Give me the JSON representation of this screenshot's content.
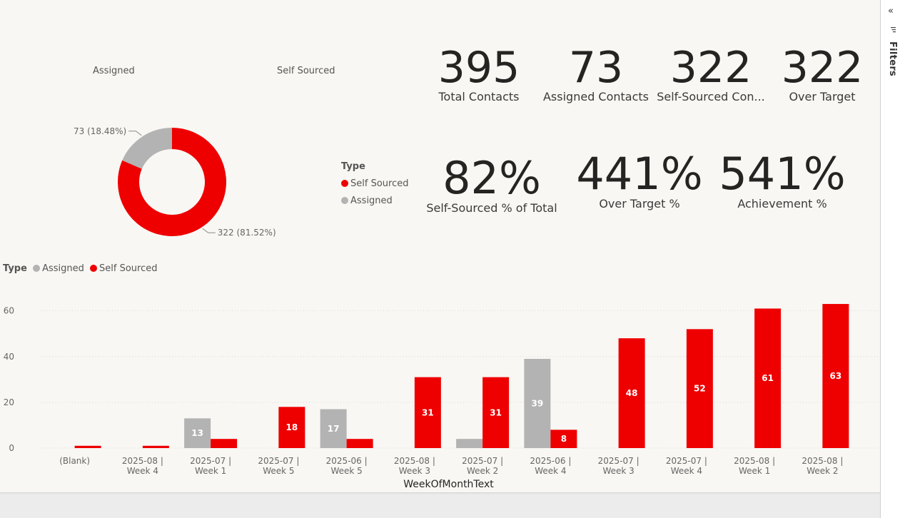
{
  "filters_pane": {
    "label": "Filters",
    "collapse_glyph": "«",
    "icons": [
      "collapse-icon",
      "filter-icon"
    ]
  },
  "card_headers": {
    "assigned": "Assigned",
    "self_sourced": "Self Sourced"
  },
  "kpis": [
    {
      "id": "total-contacts",
      "value": "395",
      "label": "Total Contacts"
    },
    {
      "id": "assigned-contacts",
      "value": "73",
      "label": "Assigned Contacts"
    },
    {
      "id": "self-sourced-contacts",
      "value": "322",
      "label": "Self-Sourced Con..."
    },
    {
      "id": "over-target",
      "value": "322",
      "label": "Over Target"
    },
    {
      "id": "self-sourced-pct",
      "value": "82%",
      "label": "Self-Sourced % of Total"
    },
    {
      "id": "over-target-pct",
      "value": "441%",
      "label": "Over Target %"
    },
    {
      "id": "achievement-pct",
      "value": "541%",
      "label": "Achievement %"
    }
  ],
  "colors": {
    "self_sourced": "#ee0000",
    "assigned": "#b3b3b3",
    "text": "#252423",
    "grid": "#d9d9d9"
  },
  "chart_data": [
    {
      "type": "pie",
      "variant": "donut",
      "legend_title": "Type",
      "legend": [
        "Self Sourced",
        "Assigned"
      ],
      "slices": [
        {
          "name": "Self Sourced",
          "value": 322,
          "label": "322 (81.52%)"
        },
        {
          "name": "Assigned",
          "value": 73,
          "label": "73 (18.48%)"
        }
      ]
    },
    {
      "type": "bar",
      "legend_title": "Type",
      "legend": [
        "Assigned",
        "Self Sourced"
      ],
      "xlabel": "WeekOfMonthText",
      "ylabel": "",
      "ylim": [
        0,
        68
      ],
      "yticks": [
        0,
        20,
        40,
        60
      ],
      "grid": true,
      "categories": [
        [
          "(Blank)"
        ],
        [
          "2025-08 |",
          "Week 4"
        ],
        [
          "2025-07 |",
          "Week 1"
        ],
        [
          "2025-07 |",
          "Week 5"
        ],
        [
          "2025-06 |",
          "Week 5"
        ],
        [
          "2025-08 |",
          "Week 3"
        ],
        [
          "2025-07 |",
          "Week 2"
        ],
        [
          "2025-06 |",
          "Week 4"
        ],
        [
          "2025-07 |",
          "Week 3"
        ],
        [
          "2025-07 |",
          "Week 4"
        ],
        [
          "2025-08 |",
          "Week 1"
        ],
        [
          "2025-08 |",
          "Week 2"
        ]
      ],
      "series": [
        {
          "name": "Assigned",
          "values": [
            null,
            null,
            13,
            null,
            17,
            null,
            4,
            39,
            null,
            null,
            null,
            null
          ]
        },
        {
          "name": "Self Sourced",
          "values": [
            1,
            1,
            4,
            18,
            4,
            31,
            31,
            8,
            48,
            52,
            61,
            63
          ]
        }
      ]
    }
  ]
}
